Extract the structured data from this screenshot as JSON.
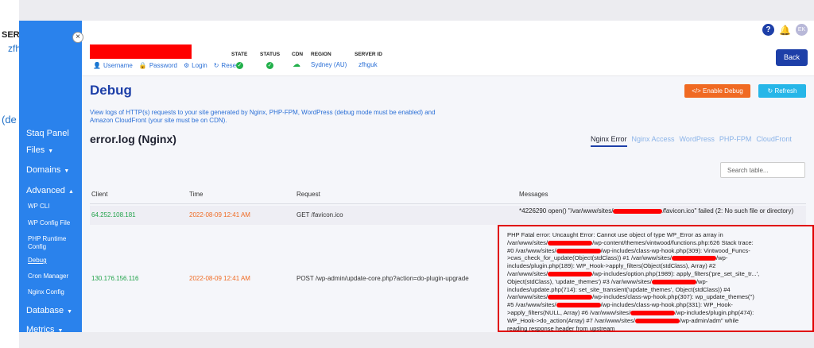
{
  "background": {
    "line1": "SER",
    "line2": "zfh",
    "line3": "(de"
  },
  "header": {
    "help_label": "?",
    "bell_label": "🔔",
    "avatar_initials": "EK"
  },
  "site_bar": {
    "links": [
      "Username",
      "Password",
      "Login",
      "Reset"
    ],
    "state_label": "STATE",
    "status_label": "STATUS",
    "cdn_label": "CDN",
    "region_label": "REGION",
    "region_value": "Sydney (AU)",
    "server_id_label": "SERVER ID",
    "server_id_value": "zfhguk",
    "back_label": "Back"
  },
  "sidebar": {
    "close_label": "×",
    "staq_panel": "Staq Panel",
    "files": "Files",
    "domains": "Domains",
    "advanced": "Advanced",
    "wp_cli": "WP CLI",
    "wp_config_file": "WP Config File",
    "php_runtime_1": "PHP Runtime",
    "php_runtime_2": "Config",
    "debug": "Debug",
    "cron_manager": "Cron Manager",
    "nginx_config": "Nginx Config",
    "database": "Database",
    "metrics": "Metrics"
  },
  "page": {
    "title": "Debug",
    "enable_debug_label": "Enable Debug",
    "refresh_label": "Refresh",
    "description": "View logs of HTTP(s) requests to your site generated by Nginx, PHP-FPM, WordPress (debug mode must be enabled) and Amazon CloudFront (your site must be on CDN).",
    "log_title": "error.log (Nginx)",
    "tabs": [
      "Nginx Error",
      "Nginx Access",
      "WordPress",
      "PHP-FPM",
      "CloudFront"
    ],
    "search_placeholder": "Search table..."
  },
  "table": {
    "headers": [
      "Client",
      "Time",
      "Request",
      "Messages"
    ],
    "rows": [
      {
        "client": "64.252.108.181",
        "time": "2022-08-09 12:41 AM",
        "request": "GET /favicon.ico",
        "message_a": "*4226290 open() \"/var/www/sites/",
        "message_b": "/favicon.ico\" failed (2: No such file or directory)"
      },
      {
        "client": "130.176.156.116",
        "time": "2022-08-09 12:41 AM",
        "request": "POST /wp-admin/update-core.php?action=do-plugin-upgrade",
        "lines": [
          "PHP Fatal error: Uncaught Error: Cannot use object of type WP_Error as array in",
          "/var/www/sites/",
          "/wp-content/themes/vintwood/functions.php:626 Stack trace:",
          "#0 /var/www/sites/",
          "/wp-includes/class-wp-hook.php(309): Vintwood_Funcs-",
          ">cws_check_for_update(Object(stdClass)) #1 /var/www/sites/",
          "/wp-",
          "includes/plugin.php(189): WP_Hook->apply_filters(Object(stdClass), Array) #2",
          "/var/www/sites/",
          "/wp-includes/option.php(1989): apply_filters('pre_set_site_tr...',",
          "Object(stdClass), 'update_themes') #3 /var/www/sites/",
          "/wp-",
          "includes/update.php(714): set_site_transient('update_themes', Object(stdClass)) #4",
          "/var/www/sites/",
          "/wp-includes/class-wp-hook.php(307): wp_update_themes('')",
          "#5 /var/www/sites/",
          "/wp-includes/class-wp-hook.php(331): WP_Hook-",
          ">apply_filters(NULL, Array) #6 /var/www/sites/",
          "/wp-includes/plugin.php(474):",
          "WP_Hook->do_action(Array) #7 /var/www/sites/",
          "/wp-admin/adm\" while",
          "reading response header from upstream"
        ]
      }
    ]
  }
}
